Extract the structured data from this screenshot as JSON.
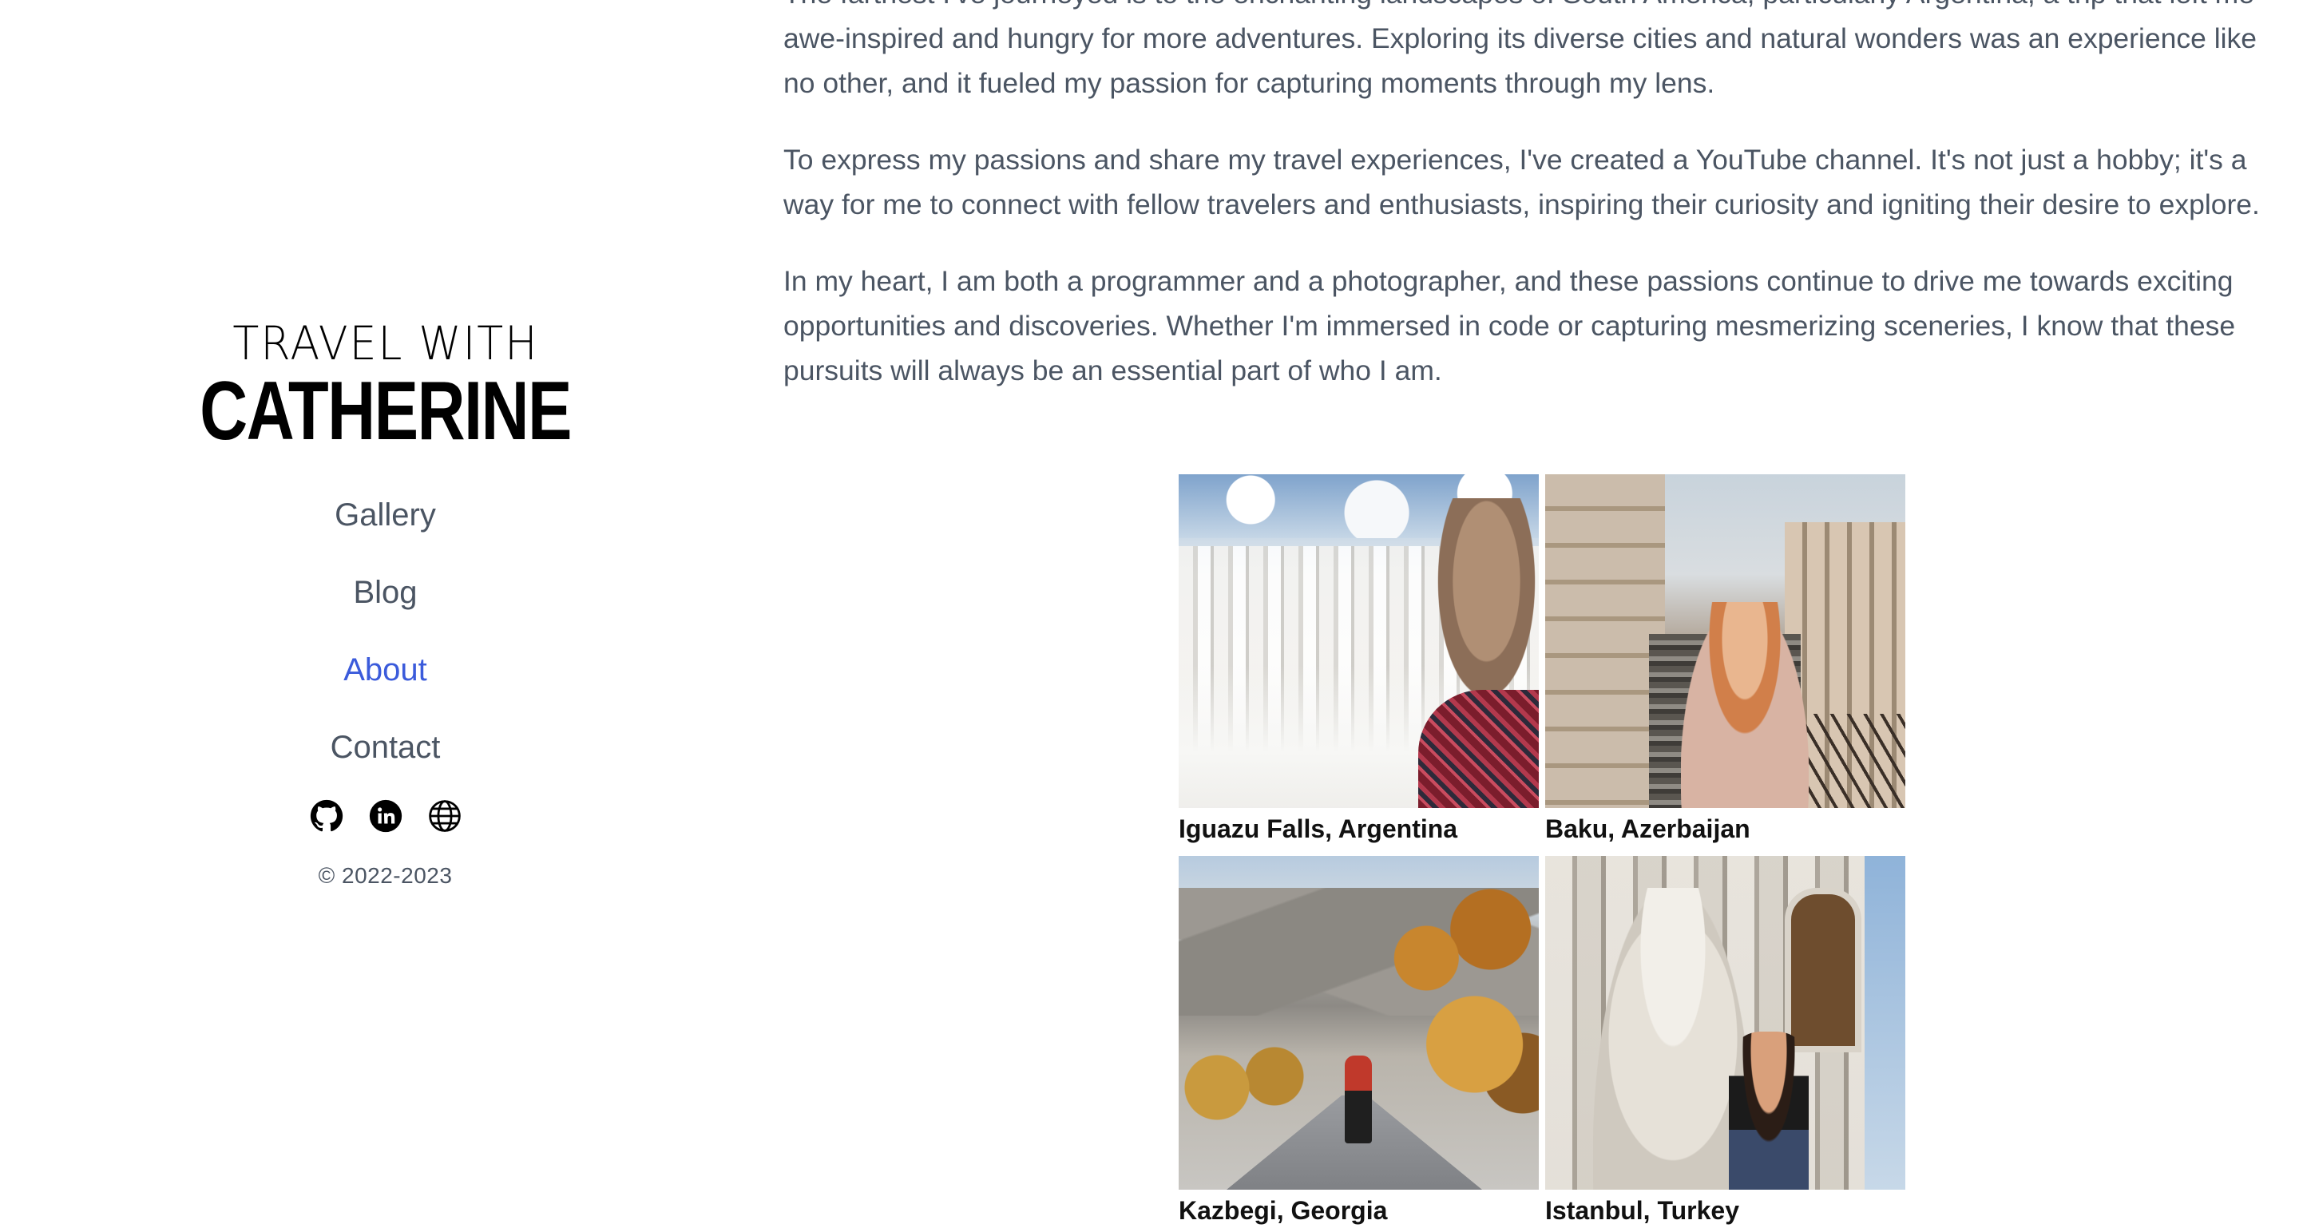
{
  "brand": {
    "line1": "TRAVEL WITH",
    "line2": "CATHERINE"
  },
  "nav": {
    "items": [
      {
        "label": "Gallery",
        "active": false
      },
      {
        "label": "Blog",
        "active": false
      },
      {
        "label": "About",
        "active": true
      },
      {
        "label": "Contact",
        "active": false
      }
    ]
  },
  "social": {
    "icons": [
      "github-icon",
      "linkedin-icon",
      "globe-icon"
    ]
  },
  "footer": {
    "copyright": "© 2022-2023"
  },
  "colors": {
    "active_link": "#3b5bdb",
    "text": "#4b5563",
    "caption": "#111111"
  },
  "about": {
    "paragraphs": [
      "The farthest I've journeyed is to the enchanting landscapes of South America, particularly Argentina, a trip that left me awe-inspired and hungry for more adventures. Exploring its diverse cities and natural wonders was an experience like no other, and it fueled my passion for capturing moments through my lens.",
      "To express my passions and share my travel experiences, I've created a YouTube channel. It's not just a hobby; it's a way for me to connect with fellow travelers and enthusiasts, inspiring their curiosity and igniting their desire to explore.",
      "In my heart, I am both a programmer and a photographer, and these passions continue to drive me towards exciting opportunities and discoveries. Whether I'm immersed in code or capturing mesmerizing sceneries, I know that these pursuits will always be an essential part of who I am."
    ]
  },
  "gallery": {
    "photos": [
      {
        "caption": "Iguazu Falls, Argentina"
      },
      {
        "caption": "Baku, Azerbaijan"
      },
      {
        "caption": "Kazbegi, Georgia"
      },
      {
        "caption": "Istanbul, Turkey"
      }
    ]
  }
}
